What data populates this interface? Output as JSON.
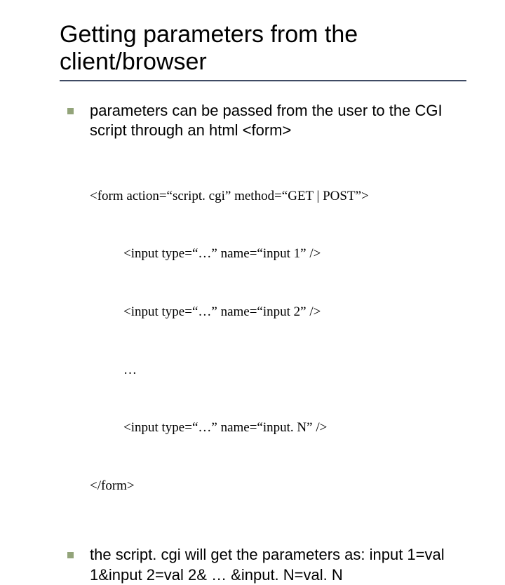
{
  "title": "Getting parameters from the client/browser",
  "bullets": {
    "b1": "parameters can be passed from the user to the CGI script through an html <form>",
    "b2": "the script. cgi will get the parameters as: input 1=val 1&input 2=val 2& … &input. N=val. N"
  },
  "code": {
    "l1": "<form action=“script. cgi” method=“GET | POST”>",
    "l2": "<input type=“…” name=“input 1” />",
    "l3": "<input type=“…” name=“input 2” />",
    "l4": "…",
    "l5": "<input type=“…” name=“input. N” />",
    "l6": "</form>"
  }
}
